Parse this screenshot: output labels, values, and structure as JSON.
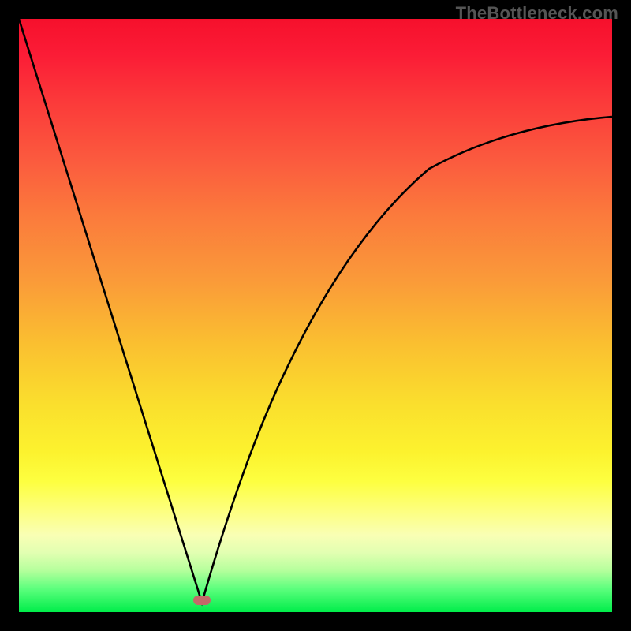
{
  "watermark": "TheBottleneck.com",
  "chart_data": {
    "type": "line",
    "title": "",
    "xlabel": "",
    "ylabel": "",
    "xlim": [
      0,
      100
    ],
    "ylim": [
      0,
      100
    ],
    "grid": false,
    "legend": false,
    "description": "Bottleneck curve: V-shaped profile over a vertical red-to-green gradient. Minimum (optimal, green) near x≈31. Left branch rises steeply and nearly linearly toward the red top; right branch rises as a concave curve approaching ~83% at the right edge.",
    "series": [
      {
        "name": "bottleneck-curve",
        "x": [
          0,
          4,
          8,
          12,
          16,
          20,
          24,
          28,
          30.8,
          34,
          38,
          42,
          46,
          50,
          54,
          58,
          62,
          66,
          70,
          74,
          78,
          82,
          86,
          90,
          94,
          98,
          100
        ],
        "values": [
          100,
          87,
          74,
          61,
          48,
          35,
          22,
          9,
          0,
          12,
          25,
          36,
          45,
          52,
          58,
          63,
          67,
          70,
          73,
          75,
          77.3,
          79,
          80.5,
          81.6,
          82.5,
          83.2,
          83.5
        ]
      }
    ],
    "vertex": {
      "x": 30.8,
      "y": 0
    },
    "marker": {
      "x": 30.8,
      "y": 1.2,
      "color": "#c36a69"
    },
    "gradient_stops": [
      {
        "pos": 0,
        "color": "#f6102c"
      },
      {
        "pos": 14,
        "color": "#fb3a3a"
      },
      {
        "pos": 33,
        "color": "#fb7a3c"
      },
      {
        "pos": 55,
        "color": "#fac030"
      },
      {
        "pos": 73,
        "color": "#fcf22e"
      },
      {
        "pos": 90,
        "color": "#e2ffb2"
      },
      {
        "pos": 100,
        "color": "#00ed4a"
      }
    ]
  }
}
